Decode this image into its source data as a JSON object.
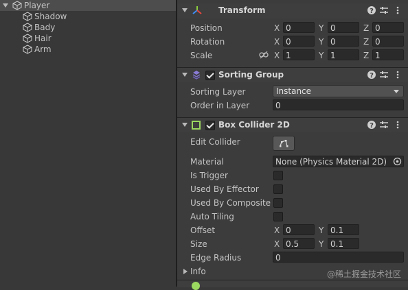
{
  "hierarchy": {
    "root": "Player",
    "children": [
      "Shadow",
      "Bady",
      "Hair",
      "Arm"
    ]
  },
  "transform": {
    "title": "Transform",
    "position": {
      "label": "Position",
      "x": "0",
      "y": "0",
      "z": "0"
    },
    "rotation": {
      "label": "Rotation",
      "x": "0",
      "y": "0",
      "z": "0"
    },
    "scale": {
      "label": "Scale",
      "x": "1",
      "y": "1",
      "z": "1"
    },
    "axis": {
      "x": "X",
      "y": "Y",
      "z": "Z"
    }
  },
  "sorting_group": {
    "title": "Sorting Group",
    "enabled": true,
    "sorting_layer_label": "Sorting Layer",
    "sorting_layer_value": "Instance",
    "order_label": "Order in Layer",
    "order_value": "0"
  },
  "box_collider": {
    "title": "Box Collider 2D",
    "enabled": true,
    "edit_collider_label": "Edit Collider",
    "material_label": "Material",
    "material_value": "None (Physics Material 2D)",
    "is_trigger_label": "Is Trigger",
    "used_by_effector_label": "Used By Effector",
    "used_by_composite_label": "Used By Composite",
    "auto_tiling_label": "Auto Tiling",
    "offset": {
      "label": "Offset",
      "x": "0",
      "y": "0.1"
    },
    "size": {
      "label": "Size",
      "x": "0.5",
      "y": "0.1"
    },
    "edge_radius": {
      "label": "Edge Radius",
      "value": "0"
    },
    "info_label": "Info"
  },
  "watermark": "@稀土掘金技术社区",
  "icons": [
    "cube-icon",
    "transform-icon",
    "sorting-group-icon",
    "box-collider-icon",
    "help-icon",
    "presets-icon",
    "more-icon",
    "link-icon",
    "edit-collider-icon",
    "object-picker-icon"
  ]
}
